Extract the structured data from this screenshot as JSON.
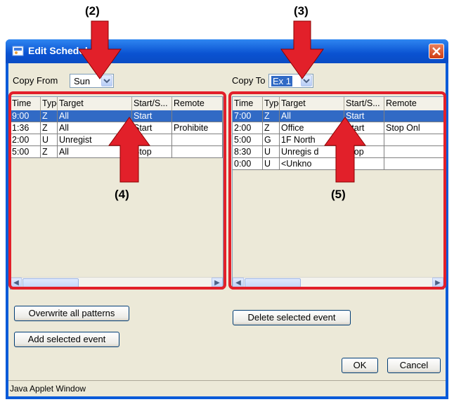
{
  "callouts": {
    "c2": "(2)",
    "c3": "(3)",
    "c4": "(4)",
    "c5": "(5)"
  },
  "window": {
    "title": "Edit Schedule",
    "status": "Java Applet Window"
  },
  "copy_from": {
    "label": "Copy From",
    "value": "Sun"
  },
  "copy_to": {
    "label": "Copy To",
    "value": "Ex 1"
  },
  "left_table": {
    "headers": [
      "Time",
      "Type",
      "Target",
      "Start/S...",
      "Remote"
    ],
    "rows": [
      [
        "9:00",
        "Z",
        "All",
        "Start",
        ""
      ],
      [
        "1:36",
        "Z",
        "All",
        "Start",
        "Prohibite"
      ],
      [
        "2:00",
        "U",
        "Unregist",
        "",
        ""
      ],
      [
        "5:00",
        "Z",
        "All",
        "Stop",
        ""
      ]
    ]
  },
  "right_table": {
    "headers": [
      "Time",
      "Type",
      "Target",
      "Start/S...",
      "Remote"
    ],
    "rows": [
      [
        "7:00",
        "Z",
        "All",
        "Start",
        ""
      ],
      [
        "2:00",
        "Z",
        "Office",
        "Start",
        "Stop Onl"
      ],
      [
        "5:00",
        "G",
        "1F North",
        "",
        ""
      ],
      [
        "8:30",
        "U",
        "Unregis d",
        "Stop",
        ""
      ],
      [
        "0:00",
        "U",
        "<Unkno",
        "",
        ""
      ]
    ]
  },
  "buttons": {
    "overwrite": "Overwrite all patterns",
    "add": "Add selected event",
    "delete": "Delete selected event",
    "ok": "OK",
    "cancel": "Cancel"
  },
  "colors": {
    "callout_red": "#e2202a",
    "selection": "#316ac5",
    "title_bar": "#0a5bd9"
  }
}
